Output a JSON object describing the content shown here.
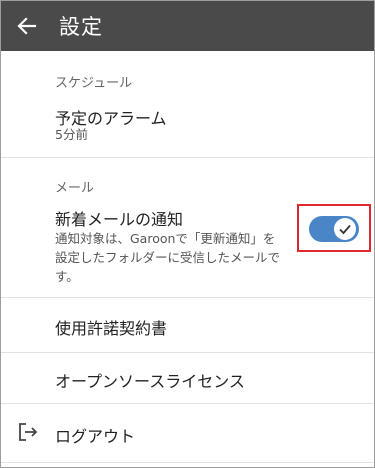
{
  "appbar": {
    "title": "設定",
    "back_icon": "arrow-left-icon"
  },
  "schedule": {
    "section_label": "スケジュール",
    "alarm_title": "予定のアラーム",
    "alarm_value": "5分前"
  },
  "mail": {
    "section_label": "メール",
    "notify_title": "新着メールの通知",
    "notify_desc_line1": "通知対象は、Garoonで「更新通知」を",
    "notify_desc_line2": "設定したフォルダーに受信したメールで",
    "notify_desc_line3": "す。",
    "notify_enabled": true,
    "toggle_color": "#4a86c7",
    "highlight_color": "#e0272c"
  },
  "items": {
    "license_agreement": "使用許諾契約書",
    "open_source": "オープンソースライセンス",
    "logout": "ログアウト",
    "logout_icon": "logout-icon"
  },
  "colors": {
    "appbar": "#4a4a4a"
  }
}
